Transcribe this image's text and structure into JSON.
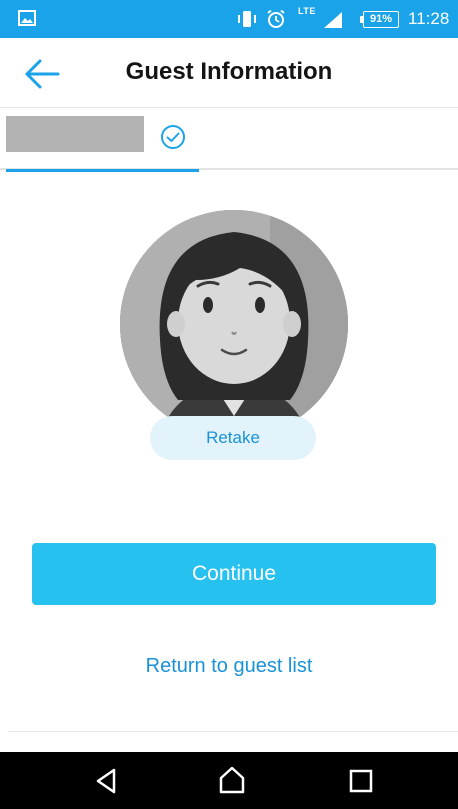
{
  "status_bar": {
    "network_label": "LTE",
    "battery_percent": "91%",
    "time": "11:28",
    "color": "#1aa3e8"
  },
  "header": {
    "title": "Guest Information",
    "back_icon": "arrow-left-icon"
  },
  "tabs": {
    "active_icon": "check-circle-icon",
    "accent_color": "#1aa3e8"
  },
  "photo": {
    "retake_label": "Retake"
  },
  "actions": {
    "continue_label": "Continue",
    "return_label": "Return to guest list",
    "primary_color": "#27c1f0",
    "link_color": "#1a92d6"
  },
  "nav_bar": {
    "back_icon": "triangle-back-icon",
    "home_icon": "home-icon",
    "recents_icon": "square-recents-icon"
  }
}
